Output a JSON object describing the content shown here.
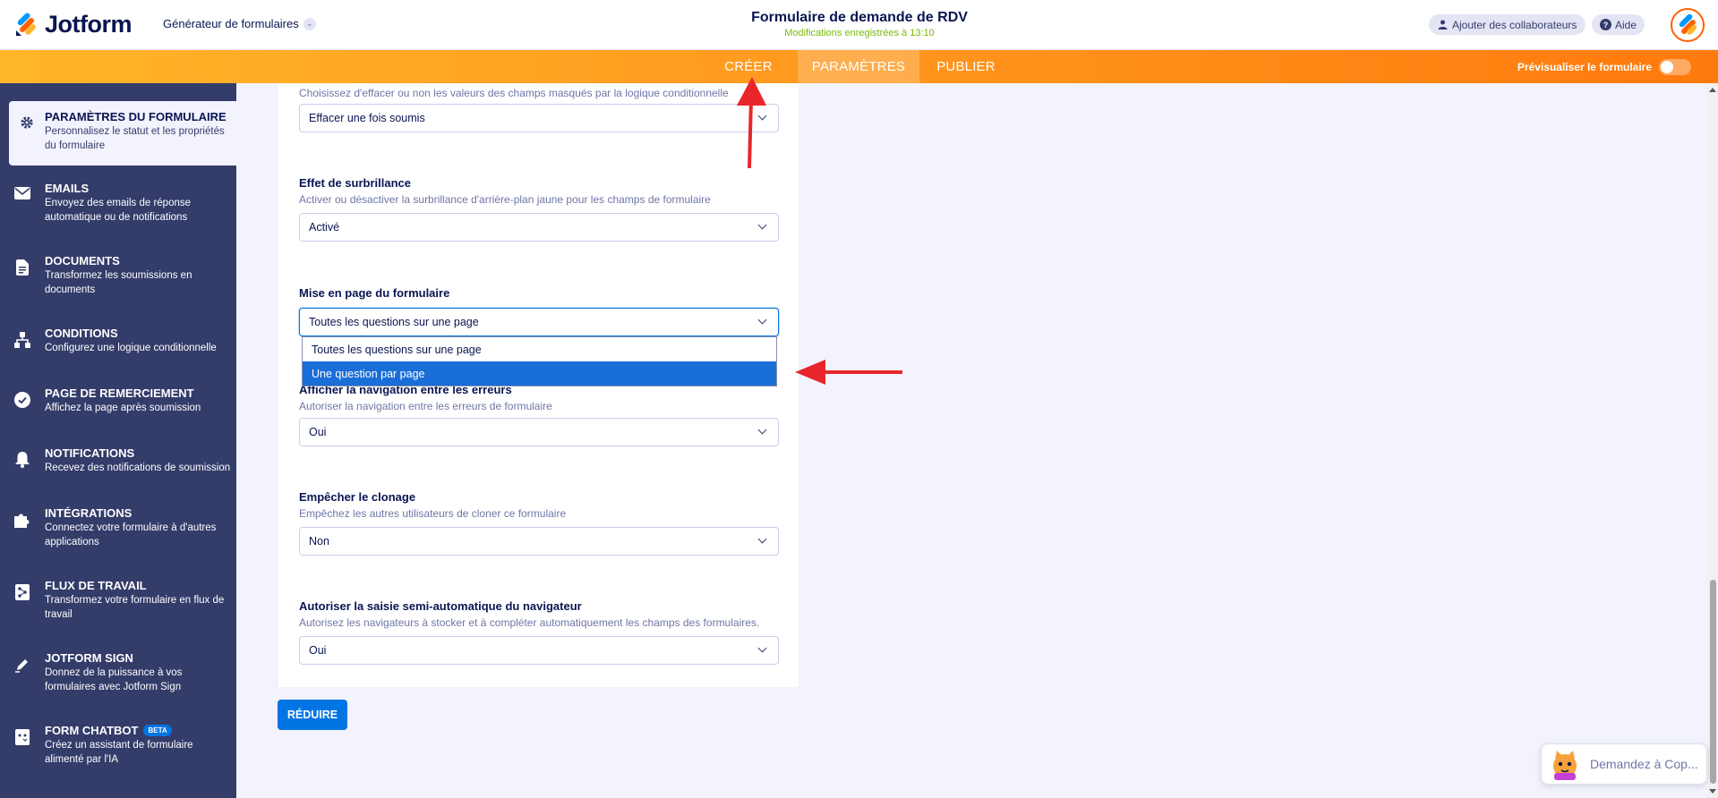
{
  "header": {
    "brand": "Jotform",
    "builder_label": "Générateur de formulaires",
    "form_title": "Formulaire de demande de RDV",
    "saved_status": "Modifications enregistrées à 13:10",
    "add_collaborators": "Ajouter des collaborateurs",
    "help": "Aide"
  },
  "nav": {
    "tabs": [
      {
        "label": "CRÉER"
      },
      {
        "label": "PARAMÈTRES"
      },
      {
        "label": "PUBLIER"
      }
    ],
    "active_tab": "PARAMÈTRES",
    "preview_label": "Prévisualiser le formulaire"
  },
  "sidebar": {
    "items": [
      {
        "title": "PARAMÈTRES DU FORMULAIRE",
        "desc": "Personnalisez le statut et les propriétés du formulaire",
        "icon": "gear-icon",
        "active": true
      },
      {
        "title": "EMAILS",
        "desc": "Envoyez des emails de réponse automatique ou de notifications",
        "icon": "envelope-icon"
      },
      {
        "title": "DOCUMENTS",
        "desc": "Transformez les soumissions en documents",
        "icon": "document-icon"
      },
      {
        "title": "CONDITIONS",
        "desc": "Configurez une logique conditionnelle",
        "icon": "hierarchy-icon"
      },
      {
        "title": "PAGE DE REMERCIEMENT",
        "desc": "Affichez la page après soumission",
        "icon": "check-circle-icon"
      },
      {
        "title": "NOTIFICATIONS",
        "desc": "Recevez des notifications de soumission",
        "icon": "bell-icon"
      },
      {
        "title": "INTÉGRATIONS",
        "desc": "Connectez votre formulaire à d'autres applications",
        "icon": "puzzle-icon"
      },
      {
        "title": "FLUX DE TRAVAIL",
        "desc": "Transformez votre formulaire en flux de travail",
        "icon": "workflow-icon"
      },
      {
        "title": "JOTFORM SIGN",
        "desc": "Donnez de la puissance à vos formulaires avec Jotform Sign",
        "icon": "pen-icon"
      },
      {
        "title": "FORM CHATBOT",
        "desc": "Créez un assistant de formulaire alimenté par l'IA",
        "icon": "chatbot-icon",
        "badge": "BETA"
      }
    ]
  },
  "settings": {
    "clear_hidden": {
      "desc": "Choisissez d'effacer ou non les valeurs des champs masqués par la logique conditionnelle",
      "value": "Effacer une fois soumis"
    },
    "highlight": {
      "label": "Effet de surbrillance",
      "desc": "Activer ou désactiver la surbrillance d'arrière-plan jaune pour les champs de formulaire",
      "value": "Activé"
    },
    "layout": {
      "label": "Mise en page du formulaire",
      "value": "Toutes les questions sur une page",
      "options": [
        "Toutes les questions sur une page",
        "Une question par page"
      ],
      "highlighted_option": "Une question par page"
    },
    "error_nav": {
      "label": "Afficher la navigation entre les erreurs",
      "desc": "Autoriser la navigation entre les erreurs de formulaire",
      "value": "Oui"
    },
    "prevent_clone": {
      "label": "Empêcher le clonage",
      "desc": "Empêchez les autres utilisateurs de cloner ce formulaire",
      "value": "Non"
    },
    "autofill": {
      "label": "Autoriser la saisie semi-automatique du navigateur",
      "desc": "Autorisez les navigateurs à stocker et à compléter automatiquement les champs des formulaires.",
      "value": "Oui"
    },
    "reduce_button": "RÉDUIRE"
  },
  "copilot": {
    "label": "Demandez à Cop..."
  },
  "colors": {
    "sidebar_bg": "#343c6a",
    "nav_orange": "#ff7a0d",
    "accent_blue": "#0075e3",
    "annotation_red": "#e8262b"
  }
}
